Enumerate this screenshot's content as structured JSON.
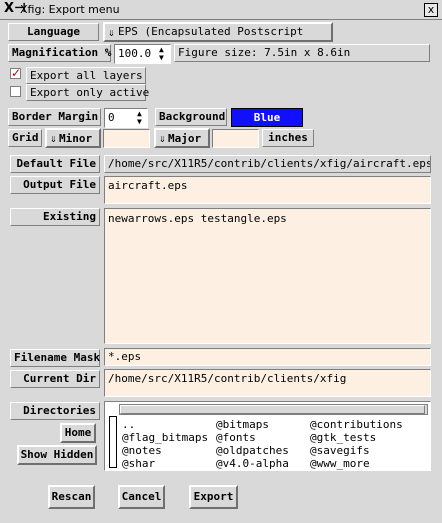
{
  "window": {
    "title": "Xfig: Export menu",
    "close_glyph": "x"
  },
  "language": {
    "label": "Language",
    "value": "EPS (Encapsulated Postscript"
  },
  "magnification": {
    "label": "Magnification %",
    "value": "100.0"
  },
  "figure_size": {
    "text": "Figure size: 7.5in x 8.6in"
  },
  "layers": {
    "export_all": "Export all layers",
    "export_only_active": "Export only active",
    "export_all_checked": true,
    "export_only_active_checked": false
  },
  "border_margin": {
    "label": "Border Margin",
    "value": "0"
  },
  "background": {
    "label": "Background",
    "value": "Blue",
    "color": "#1010ff"
  },
  "grid": {
    "label": "Grid",
    "minor_label": "Minor",
    "major_label": "Major",
    "minor_value": "",
    "major_value": "",
    "units": "inches"
  },
  "default_file": {
    "label": "Default File",
    "value": "/home/src/X11R5/contrib/clients/xfig/aircraft.eps"
  },
  "output_file": {
    "label": "Output File",
    "value": "aircraft.eps"
  },
  "existing": {
    "label": "Existing",
    "value": "newarrows.eps testangle.eps"
  },
  "filename_mask": {
    "label": "Filename Mask",
    "value": "*.eps"
  },
  "current_dir": {
    "label": "Current Dir",
    "value": "/home/src/X11R5/contrib/clients/xfig"
  },
  "directories": {
    "label": "Directories",
    "home_button": "Home",
    "show_hidden_button": "Show Hidden",
    "items": [
      "..",
      "@bitmaps",
      "@contributions",
      "@flag_bitmaps",
      "@fonts",
      "@gtk_tests",
      "@notes",
      "@oldpatches",
      "@savegifs",
      "@shar",
      "@v4.0-alpha",
      "@www_more"
    ]
  },
  "buttons": {
    "rescan": "Rescan",
    "cancel": "Cancel",
    "export": "Export"
  }
}
